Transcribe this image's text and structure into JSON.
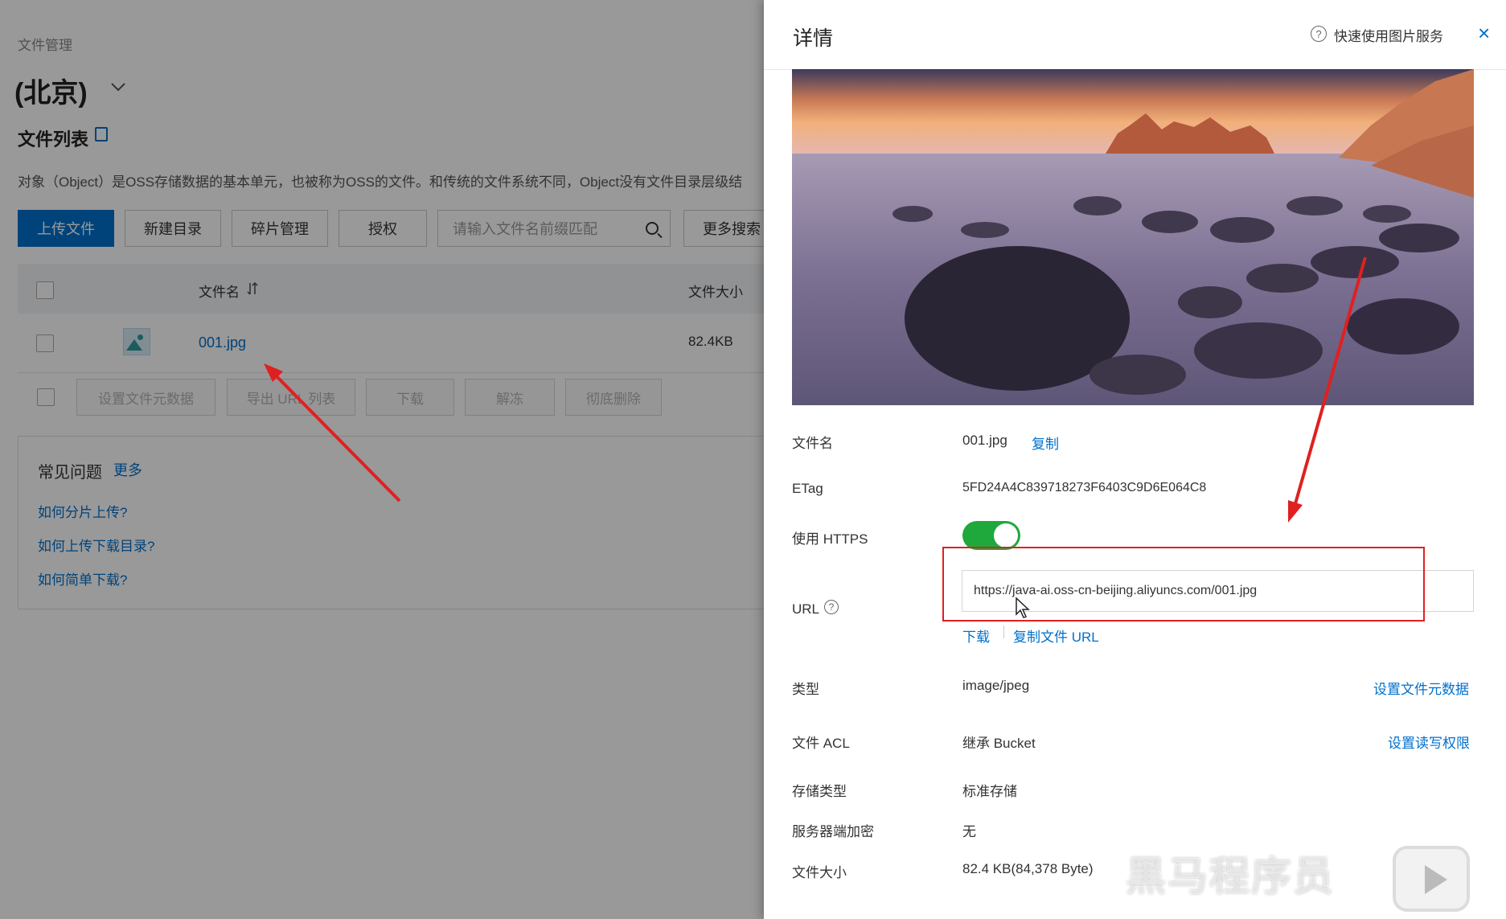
{
  "left": {
    "breadcrumb": "文件管理",
    "region_title": "(北京)",
    "list_title": "文件列表",
    "description": "对象（Object）是OSS存储数据的基本单元，也被称为OSS的文件。和传统的文件系统不同，Object没有文件目录层级结",
    "buttons": {
      "upload": "上传文件",
      "new_dir": "新建目录",
      "fragments": "碎片管理",
      "authorize": "授权",
      "more_search": "更多搜索"
    },
    "search_placeholder": "请输入文件名前缀匹配",
    "table": {
      "col_name": "文件名",
      "col_size": "文件大小",
      "rows": [
        {
          "name": "001.jpg",
          "size": "82.4KB"
        }
      ]
    },
    "batch_buttons": {
      "set_meta": "设置文件元数据",
      "export_url": "导出 URL 列表",
      "download": "下载",
      "unfreeze": "解冻",
      "delete": "彻底删除"
    },
    "faq": {
      "title": "常见问题",
      "more": "更多",
      "items": [
        "如何分片上传?",
        "如何上传下载目录?",
        "如何简单下载?"
      ]
    }
  },
  "drawer": {
    "title": "详情",
    "help_text": "快速使用图片服务",
    "close": "×",
    "fields": {
      "filename_label": "文件名",
      "filename_value": "001.jpg",
      "copy_link": "复制",
      "etag_label": "ETag",
      "etag_value": "5FD24A4C839718273F6403C9D6E064C8",
      "https_label": "使用 HTTPS",
      "https_enabled": true,
      "url_label": "URL",
      "url_value": "https://java-ai.oss-cn-beijing.aliyuncs.com/001.jpg",
      "download_link": "下载",
      "copy_url_link": "复制文件 URL",
      "type_label": "类型",
      "type_value": "image/jpeg",
      "set_meta_link": "设置文件元数据",
      "acl_label": "文件 ACL",
      "acl_value": "继承 Bucket",
      "set_acl_link": "设置读写权限",
      "storage_label": "存储类型",
      "storage_value": "标准存储",
      "encrypt_label": "服务器端加密",
      "encrypt_value": "无",
      "size_label": "文件大小",
      "size_value": "82.4 KB(84,378 Byte)"
    }
  },
  "watermark": "黑马程序员",
  "colors": {
    "primary": "#0070cc",
    "toggle_on": "#1fa83c",
    "annotation_red": "#e02020"
  }
}
